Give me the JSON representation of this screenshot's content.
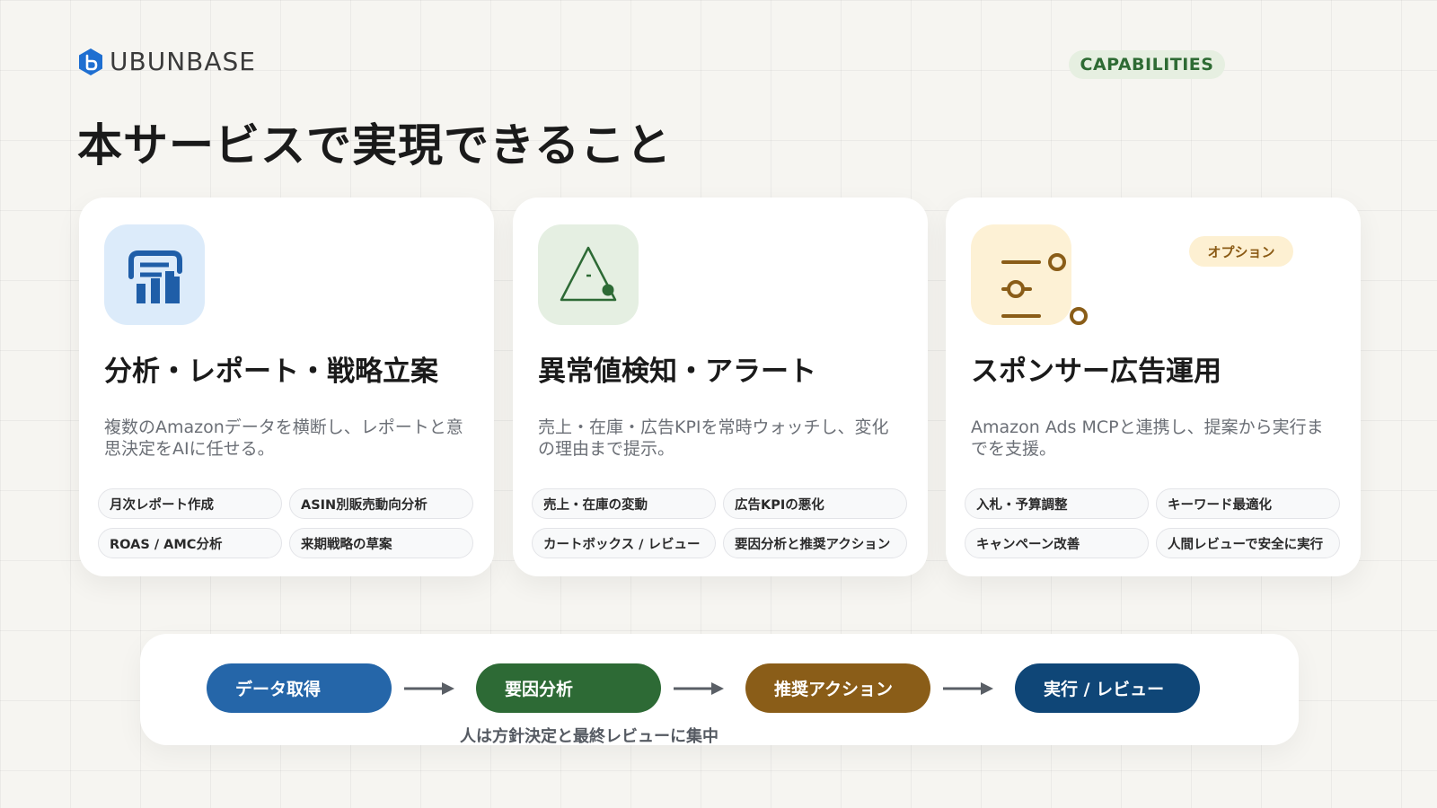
{
  "brand": {
    "name": "UBUNBASE"
  },
  "badge": {
    "label": "CAPABILITIES"
  },
  "page": {
    "title": "本サービスで実現できること"
  },
  "cards": [
    {
      "icon": "report-chart-icon",
      "title": "分析・レポート・戦略立案",
      "description": "複数のAmazonデータを横断し、レポートと意思決定をAIに任せる。",
      "chips": [
        "月次レポート作成",
        "ASIN別販売動向分析",
        "ROAS / AMC分析",
        "来期戦略の草案"
      ]
    },
    {
      "icon": "alert-triangle-icon",
      "title": "異常値検知・アラート",
      "description": "売上・在庫・広告KPIを常時ウォッチし、変化の理由まで提示。",
      "chips": [
        "売上・在庫の変動",
        "広告KPIの悪化",
        "カートボックス / レビュー",
        "要因分析と推奨アクション"
      ]
    },
    {
      "icon": "sliders-icon",
      "title": "スポンサー広告運用",
      "badge": "オプション",
      "description": "Amazon Ads MCPと連携し、提案から実行までを支援。",
      "chips": [
        "入札・予算調整",
        "キーワード最適化",
        "キャンペーン改善",
        "人間レビューで安全に実行"
      ]
    }
  ],
  "flow": {
    "steps": [
      "データ取得",
      "要因分析",
      "推奨アクション",
      "実行 / レビュー"
    ],
    "note": "人は方針決定と最終レビューに集中"
  },
  "colors": {
    "background": "#f6f5f1",
    "blue": "#2566a9",
    "green": "#2d6a35",
    "amber": "#8a5d18",
    "navy": "#0f4677",
    "badge_green": "#2e6b34"
  }
}
